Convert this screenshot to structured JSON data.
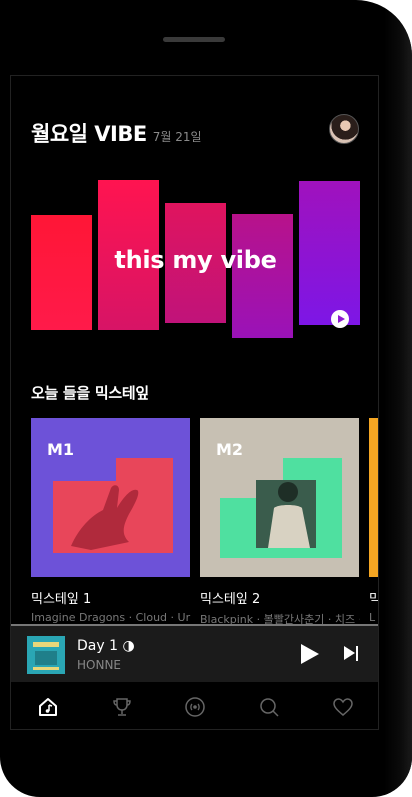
{
  "header": {
    "title": "월요일 VIBE",
    "date": "7월 21일"
  },
  "hero": {
    "title": "this my vibe",
    "gradient_start": "#ff1a3a",
    "gradient_end": "#8a1cff"
  },
  "mixtapes": {
    "section_title": "오늘 들을 믹스테잎",
    "items": [
      {
        "tag": "M1",
        "label": "믹스테잎 1",
        "subtitle": "Imagine Dragons · Cloud · Urban Zakapa",
        "bg": "#6d52d8"
      },
      {
        "tag": "M2",
        "label": "믹스테잎 2",
        "subtitle": "Blackpink · 볼빨간사춘기 · 치즈 · 잔나비",
        "bg": "#c7c0b3"
      },
      {
        "label": "믹",
        "subtitle": "L",
        "bg": "#f5a623"
      }
    ]
  },
  "now_playing": {
    "title": "Day 1 ◑",
    "artist": "HONNE"
  },
  "tabs": [
    "home-icon",
    "trophy-icon",
    "radio-icon",
    "search-icon",
    "heart-icon"
  ]
}
